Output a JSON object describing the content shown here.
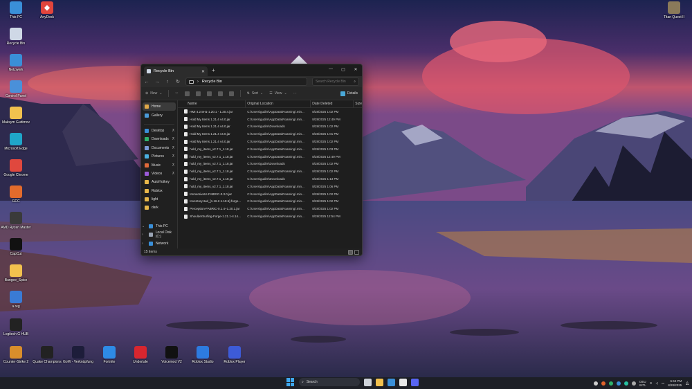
{
  "desktop": {
    "icons_left": [
      {
        "label": "This PC",
        "icon": "monitor-icon",
        "color": "#3a8fd8",
        "glyph": ""
      },
      {
        "label": "Recycle Bin",
        "icon": "recycle-bin-icon",
        "color": "#cfd8e6",
        "glyph": ""
      },
      {
        "label": "Netzwerk",
        "icon": "network-icon",
        "color": "#3a8fd8",
        "glyph": ""
      },
      {
        "label": "Control Panel",
        "icon": "control-panel-icon",
        "color": "#4a90d9",
        "glyph": ""
      },
      {
        "label": "Maksym Gudimov",
        "icon": "folder-icon",
        "color": "#f2c14e",
        "glyph": ""
      },
      {
        "label": "Microsoft Edge",
        "icon": "edge-icon",
        "color": "#1fa6c9",
        "glyph": ""
      },
      {
        "label": "Google Chrome",
        "icon": "chrome-icon",
        "color": "#e0483e",
        "glyph": ""
      },
      {
        "label": "GCC",
        "icon": "gcc-icon",
        "color": "#e36b2c",
        "glyph": ""
      },
      {
        "label": "AMD Ryzen Master",
        "icon": "amd-icon",
        "color": "#3a3a3a",
        "glyph": ""
      },
      {
        "label": "CapCut",
        "icon": "capcut-icon",
        "color": "#111111",
        "glyph": ""
      },
      {
        "label": "Bungee_Spice",
        "icon": "folder-icon",
        "color": "#f2c14e",
        "glyph": ""
      },
      {
        "label": "a.reg",
        "icon": "registry-icon",
        "color": "#3a7bd5",
        "glyph": ""
      },
      {
        "label": "Logitech G HUB",
        "icon": "logitech-icon",
        "color": "#222222",
        "glyph": ""
      }
    ],
    "icon_top_second": {
      "label": "AnyDesk",
      "icon": "anydesk-icon",
      "color": "#e2453c"
    },
    "icon_top_right": {
      "label": "Titan Quest II",
      "icon": "titan-quest-icon",
      "color": "#8a7a5a"
    },
    "icons_bottom": [
      {
        "label": "Counter-Strike 2",
        "icon": "cs2-icon",
        "color": "#d98e2b"
      },
      {
        "label": "Quake Champions",
        "icon": "quake-icon",
        "color": "#222222"
      },
      {
        "label": "GoW - Verknüpfung",
        "icon": "gow-icon",
        "color": "#1d1d3a"
      },
      {
        "label": "Fortnite",
        "icon": "fortnite-icon",
        "color": "#2e8be6"
      },
      {
        "label": "Undertale",
        "icon": "undertale-icon",
        "color": "#d8262f"
      },
      {
        "label": "Voicemod V2",
        "icon": "voicemod-icon",
        "color": "#111111"
      },
      {
        "label": "Roblox Studio",
        "icon": "roblox-studio-icon",
        "color": "#2d7be0"
      },
      {
        "label": "Roblox Player",
        "icon": "roblox-player-icon",
        "color": "#3d5bd8"
      }
    ]
  },
  "explorer": {
    "tab_title": "Recycle Bin",
    "address": "Recycle Bin",
    "search_placeholder": "Search Recycle Bin",
    "toolbar": {
      "new": "New",
      "sort": "Sort",
      "view": "View",
      "more": "···",
      "details": "Details"
    },
    "nav": {
      "quick": [
        {
          "label": "Home",
          "icon": "home-icon",
          "color": "#e0a848",
          "selected": true
        },
        {
          "label": "Gallery",
          "icon": "gallery-icon",
          "color": "#4a9ad8",
          "selected": false
        }
      ],
      "pinned": [
        {
          "label": "Desktop",
          "icon": "desktop-icon",
          "color": "#3a8fd8",
          "pinned": true
        },
        {
          "label": "Downloads",
          "icon": "downloads-icon",
          "color": "#2fb46c",
          "pinned": true
        },
        {
          "label": "Documents",
          "icon": "documents-icon",
          "color": "#7a9ad8",
          "pinned": true
        },
        {
          "label": "Pictures",
          "icon": "pictures-icon",
          "color": "#4ab0e0",
          "pinned": true
        },
        {
          "label": "Music",
          "icon": "music-icon",
          "color": "#e06a3a",
          "pinned": true
        },
        {
          "label": "Videos",
          "icon": "videos-icon",
          "color": "#9a5ad8",
          "pinned": true
        },
        {
          "label": "AutoHotkey",
          "icon": "folder-icon",
          "color": "#e8b84a",
          "pinned": false
        },
        {
          "label": "Roblox",
          "icon": "folder-icon",
          "color": "#e8b84a",
          "pinned": false
        },
        {
          "label": "light",
          "icon": "folder-icon",
          "color": "#e8b84a",
          "pinned": false
        },
        {
          "label": "dark",
          "icon": "folder-icon",
          "color": "#e8b84a",
          "pinned": false
        }
      ],
      "drives": [
        {
          "label": "This PC",
          "icon": "this-pc-icon",
          "color": "#3a8fd8",
          "chev": "⌄"
        },
        {
          "label": "Local Disk (C:)",
          "icon": "drive-icon",
          "color": "#9aa4b4",
          "chev": "›"
        },
        {
          "label": "Network",
          "icon": "network-icon",
          "color": "#3a8fd8",
          "chev": "›"
        }
      ]
    },
    "columns": [
      "Name",
      "Original Location",
      "Date Deleted",
      "Size"
    ],
    "rows": [
      {
        "name": "HMI 4.2.5H1-1.20.1 - 1.20.4.jar",
        "loc": "C:\\Users\\gudim\\AppData\\Roaming\\.min...",
        "date": "8/28/2025 1:02 PM"
      },
      {
        "name": "Hold My Items 1.21.4 v4.0.jar",
        "loc": "C:\\Users\\gudim\\AppData\\Roaming\\.min...",
        "date": "8/28/2025 12:49 PM"
      },
      {
        "name": "Hold My Items 1.21.4 v4.0.jar",
        "loc": "C:\\Users\\gudim\\Downloads",
        "date": "8/28/2025 1:02 PM"
      },
      {
        "name": "Hold My Items 1.21.4 v4.0.jar",
        "loc": "C:\\Users\\gudim\\AppData\\Roaming\\.min...",
        "date": "8/28/2025 1:01 PM"
      },
      {
        "name": "Hold My Items 1.21.4 v4.0.jar",
        "loc": "C:\\Users\\gudim\\AppData\\Roaming\\.min...",
        "date": "8/28/2025 1:02 PM"
      },
      {
        "name": "hold_my_items_v2.7.1_1.18.jar",
        "loc": "C:\\Users\\gudim\\AppData\\Roaming\\.min...",
        "date": "8/28/2025 1:03 PM"
      },
      {
        "name": "hold_my_items_v2.7.1_1.18.jar",
        "loc": "C:\\Users\\gudim\\AppData\\Roaming\\.min...",
        "date": "8/28/2025 12:49 PM"
      },
      {
        "name": "hold_my_items_v2.7.1_1.18.jar",
        "loc": "C:\\Users\\gudim\\Downloads",
        "date": "8/28/2025 1:02 PM"
      },
      {
        "name": "hold_my_items_v2.7.1_1.18.jar",
        "loc": "C:\\Users\\gudim\\AppData\\Roaming\\.min...",
        "date": "8/28/2025 1:02 PM"
      },
      {
        "name": "hold_my_items_v2.7.1_1.18.jar",
        "loc": "C:\\Users\\gudim\\Downloads",
        "date": "8/28/2025 1:13 PM"
      },
      {
        "name": "hold_my_items_v2.7.1_1.18.jar",
        "loc": "C:\\Users\\gudim\\AppData\\Roaming\\.min...",
        "date": "8/28/2025 1:06 PM"
      },
      {
        "name": "ImmersiveUI-FABRIC-0.3.0.jar",
        "loc": "C:\\Users\\gudim\\AppData\\Roaming\\.min...",
        "date": "8/28/2025 1:02 PM"
      },
      {
        "name": "InventoryHud_[1.16.2-1.18.5]-forge...",
        "loc": "C:\\Users\\gudim\\AppData\\Roaming\\.min...",
        "date": "8/28/2025 1:02 PM"
      },
      {
        "name": "Perception-FABRIC-0.1.4+1.20.1.jar",
        "loc": "C:\\Users\\gudim\\AppData\\Roaming\\.min...",
        "date": "8/28/2025 1:02 PM"
      },
      {
        "name": "ShoulderSurfing-Forge-1.21.1-4.14...",
        "loc": "C:\\Users\\gudim\\AppData\\Roaming\\.min...",
        "date": "8/28/2025 12:54 PM"
      }
    ],
    "status": "15 items"
  },
  "taskbar": {
    "search_label": "Search",
    "apps": [
      {
        "icon": "task-view-icon",
        "color": "#cfd3da"
      },
      {
        "icon": "file-explorer-icon",
        "color": "#f2c14e"
      },
      {
        "icon": "store-icon",
        "color": "#3a8fd8"
      },
      {
        "icon": "calendar-icon",
        "color": "#e8e8e8"
      },
      {
        "icon": "discord-icon",
        "color": "#5865f2"
      }
    ],
    "tray_icons": [
      {
        "icon": "chevron-up-icon",
        "color": "#cccccc"
      },
      {
        "icon": "tray-app-icon",
        "color": "#e0632c"
      },
      {
        "icon": "tray-app-icon",
        "color": "#2fb46c"
      },
      {
        "icon": "tray-app-icon",
        "color": "#3a8fd8"
      },
      {
        "icon": "tray-app-icon",
        "color": "#28c0a0"
      },
      {
        "icon": "tray-app-icon",
        "color": "#aaaaaa"
      }
    ],
    "lang_1": "DEU",
    "lang_2": "INTL",
    "time": "6:44 PM",
    "date": "8/28/2025"
  }
}
